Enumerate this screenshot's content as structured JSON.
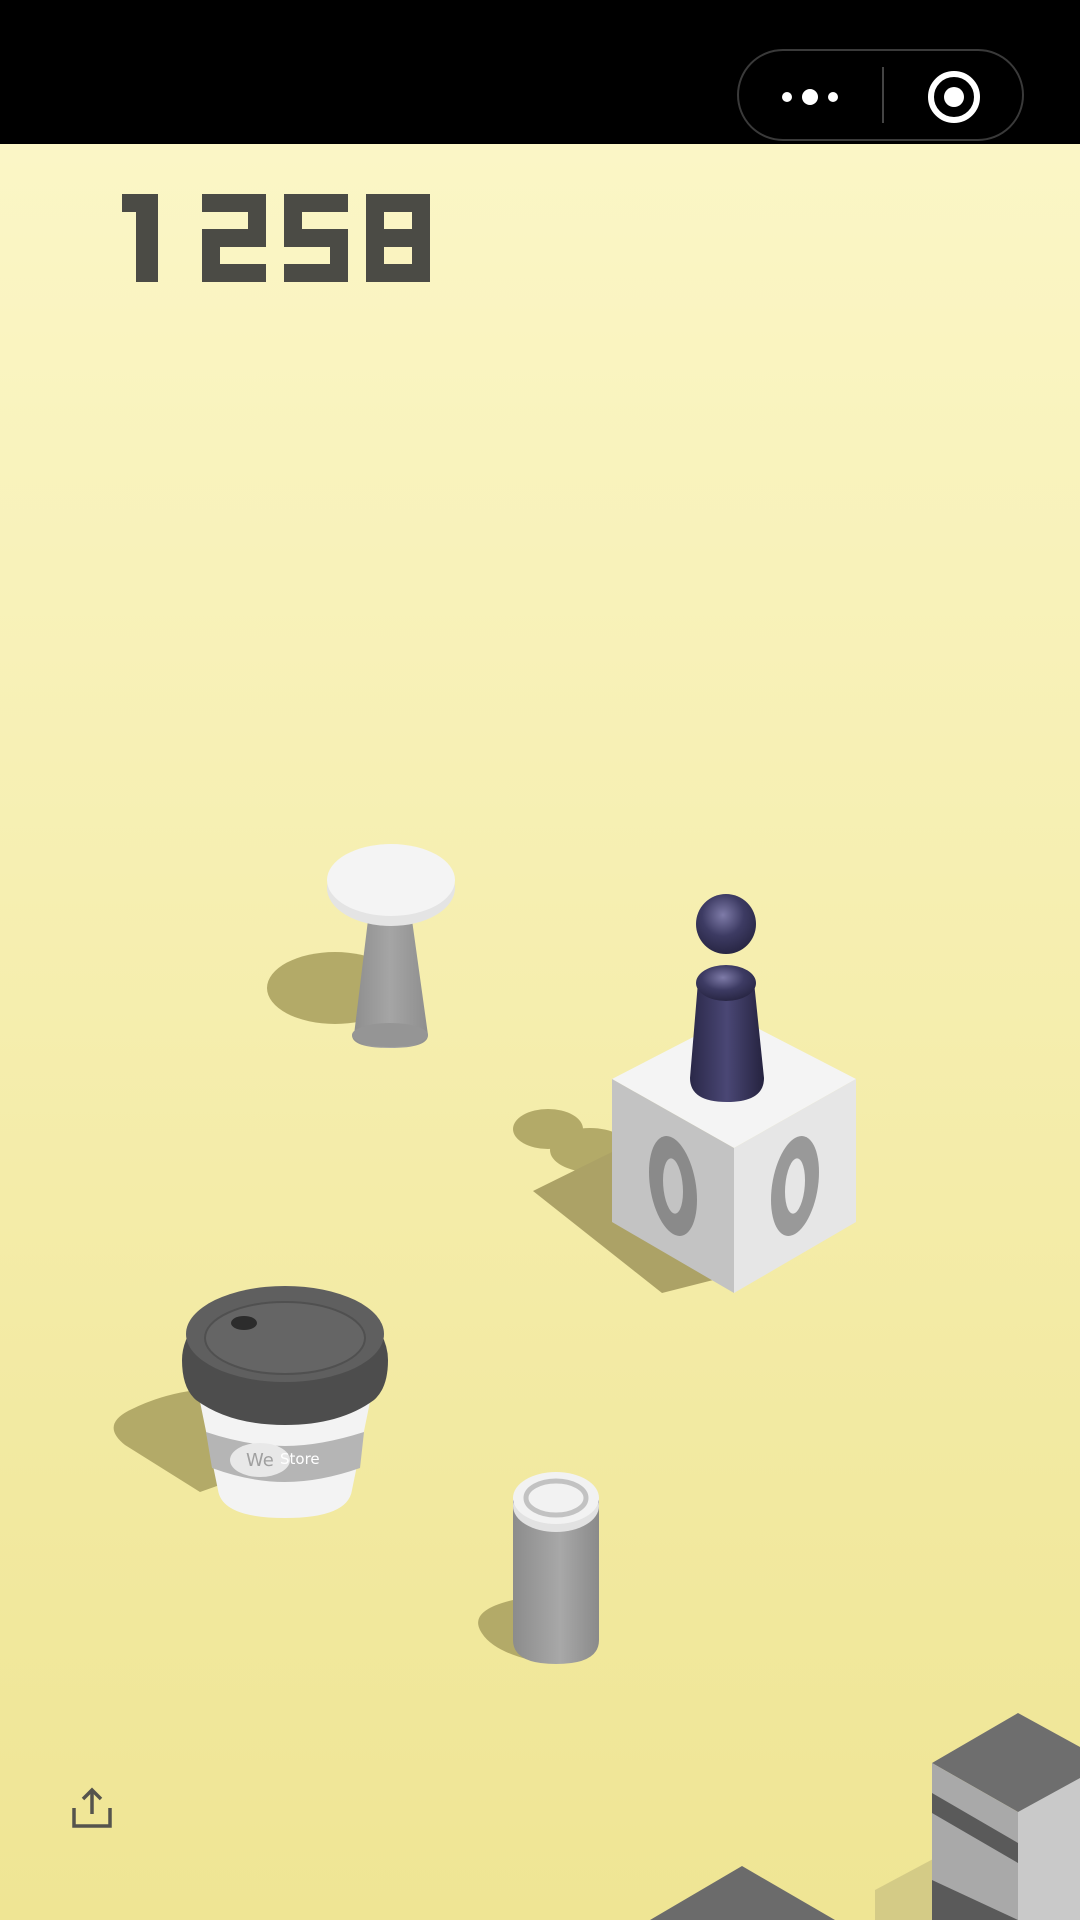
{
  "game": {
    "score": "1258",
    "background_top_color": "#fbf6c6",
    "background_bottom_color": "#efe595"
  },
  "topbar": {
    "color": "#000000",
    "menu_icon": "more-dots-icon",
    "close_icon": "target-circle-icon"
  },
  "objects": {
    "player": {
      "color": "#3d3b63"
    },
    "cup": {
      "brand_part1": "We",
      "brand_part2": "Store"
    }
  },
  "bottom": {
    "share_icon": "share-upload-icon"
  }
}
